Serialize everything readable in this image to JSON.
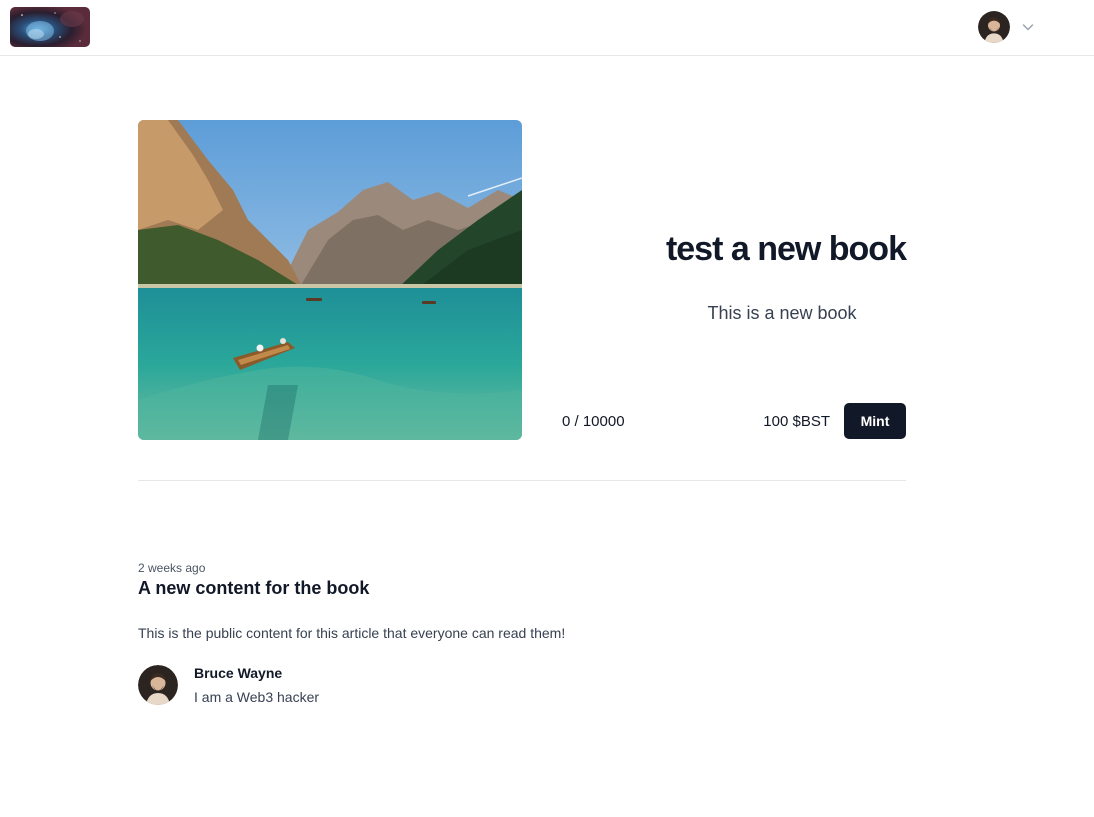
{
  "header": {
    "logo_icon": "nebula-logo",
    "user_avatar_icon": "user-avatar",
    "menu_icon": "chevron-down-icon"
  },
  "book": {
    "title": "test a new book",
    "description": "This is a new book",
    "supply": "0 / 10000",
    "price": "100 $BST",
    "mint_label": "Mint"
  },
  "article": {
    "time": "2 weeks ago",
    "title": "A new content for the book",
    "body": "This is the public content for this article that everyone can read them!",
    "author": {
      "name": "Bruce Wayne",
      "bio": "I am a Web3 hacker"
    }
  },
  "colors": {
    "primary": "#111827",
    "border": "#e5e7eb",
    "muted_text": "#374151"
  }
}
